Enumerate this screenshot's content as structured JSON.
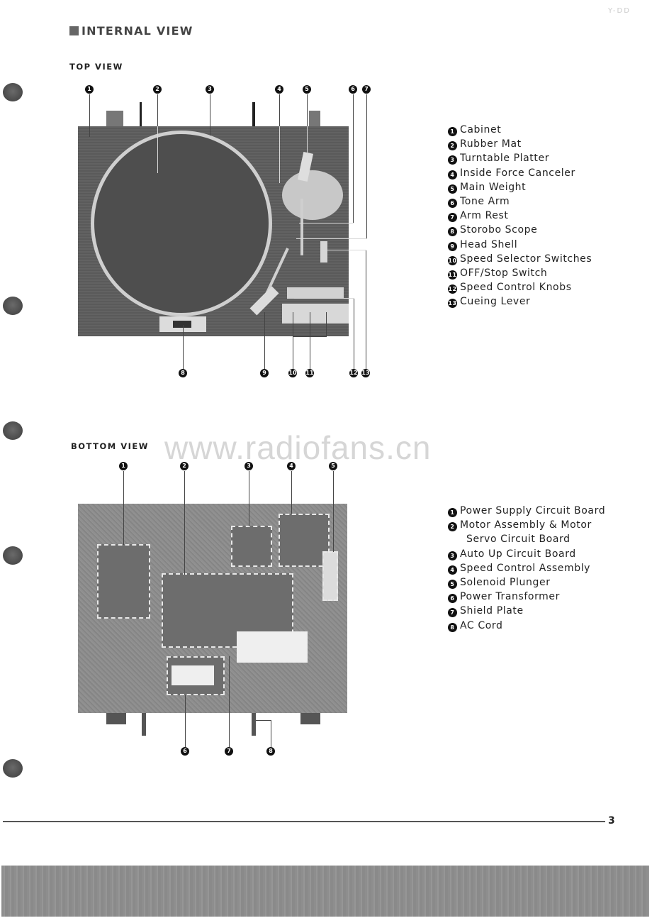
{
  "page": {
    "corner_ref": "Y-DD",
    "main_title": "INTERNAL VIEW",
    "page_number": "3",
    "watermark": "www.radiofans.cn"
  },
  "top_view": {
    "title": "TOP VIEW",
    "callouts": [
      "1",
      "2",
      "3",
      "4",
      "5",
      "6",
      "7",
      "8",
      "9",
      "10",
      "11",
      "12",
      "13"
    ],
    "legend": [
      {
        "num": "1",
        "label": "Cabinet"
      },
      {
        "num": "2",
        "label": "Rubber Mat"
      },
      {
        "num": "3",
        "label": "Turntable Platter"
      },
      {
        "num": "4",
        "label": "Inside Force Canceler"
      },
      {
        "num": "5",
        "label": "Main Weight"
      },
      {
        "num": "6",
        "label": "Tone Arm"
      },
      {
        "num": "7",
        "label": "Arm Rest"
      },
      {
        "num": "8",
        "label": "Storobo Scope"
      },
      {
        "num": "9",
        "label": "Head Shell"
      },
      {
        "num": "10",
        "label": "Speed Selector Switches"
      },
      {
        "num": "11",
        "label": "OFF/Stop Switch"
      },
      {
        "num": "12",
        "label": "Speed Control Knobs"
      },
      {
        "num": "13",
        "label": "Cueing Lever"
      }
    ]
  },
  "bottom_view": {
    "title": "BOTTOM VIEW",
    "callouts": [
      "1",
      "2",
      "3",
      "4",
      "5",
      "6",
      "7",
      "8"
    ],
    "legend": [
      {
        "num": "1",
        "label": "Power Supply Circuit Board"
      },
      {
        "num": "2",
        "label": "Motor Assembly & Motor",
        "continuation": "Servo Circuit Board"
      },
      {
        "num": "3",
        "label": "Auto Up Circuit Board"
      },
      {
        "num": "4",
        "label": "Speed Control Assembly"
      },
      {
        "num": "5",
        "label": "Solenoid Plunger"
      },
      {
        "num": "6",
        "label": "Power Transformer"
      },
      {
        "num": "7",
        "label": "Shield Plate"
      },
      {
        "num": "8",
        "label": "AC Cord"
      }
    ]
  }
}
